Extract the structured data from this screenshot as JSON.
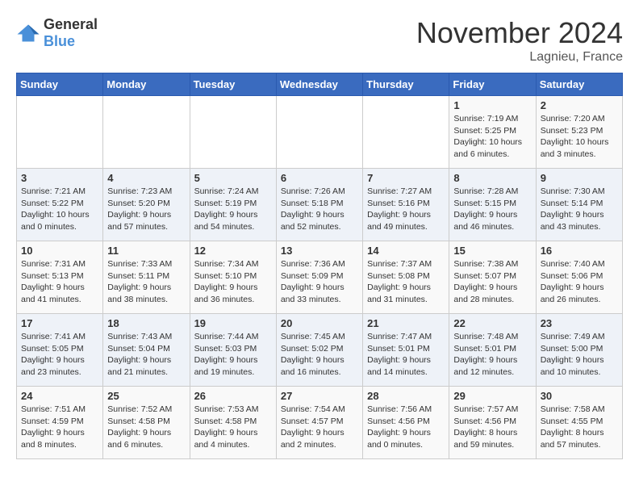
{
  "logo": {
    "general": "General",
    "blue": "Blue"
  },
  "title": "November 2024",
  "location": "Lagnieu, France",
  "days_of_week": [
    "Sunday",
    "Monday",
    "Tuesday",
    "Wednesday",
    "Thursday",
    "Friday",
    "Saturday"
  ],
  "weeks": [
    [
      {
        "day": "",
        "info": ""
      },
      {
        "day": "",
        "info": ""
      },
      {
        "day": "",
        "info": ""
      },
      {
        "day": "",
        "info": ""
      },
      {
        "day": "",
        "info": ""
      },
      {
        "day": "1",
        "info": "Sunrise: 7:19 AM\nSunset: 5:25 PM\nDaylight: 10 hours\nand 6 minutes."
      },
      {
        "day": "2",
        "info": "Sunrise: 7:20 AM\nSunset: 5:23 PM\nDaylight: 10 hours\nand 3 minutes."
      }
    ],
    [
      {
        "day": "3",
        "info": "Sunrise: 7:21 AM\nSunset: 5:22 PM\nDaylight: 10 hours\nand 0 minutes."
      },
      {
        "day": "4",
        "info": "Sunrise: 7:23 AM\nSunset: 5:20 PM\nDaylight: 9 hours\nand 57 minutes."
      },
      {
        "day": "5",
        "info": "Sunrise: 7:24 AM\nSunset: 5:19 PM\nDaylight: 9 hours\nand 54 minutes."
      },
      {
        "day": "6",
        "info": "Sunrise: 7:26 AM\nSunset: 5:18 PM\nDaylight: 9 hours\nand 52 minutes."
      },
      {
        "day": "7",
        "info": "Sunrise: 7:27 AM\nSunset: 5:16 PM\nDaylight: 9 hours\nand 49 minutes."
      },
      {
        "day": "8",
        "info": "Sunrise: 7:28 AM\nSunset: 5:15 PM\nDaylight: 9 hours\nand 46 minutes."
      },
      {
        "day": "9",
        "info": "Sunrise: 7:30 AM\nSunset: 5:14 PM\nDaylight: 9 hours\nand 43 minutes."
      }
    ],
    [
      {
        "day": "10",
        "info": "Sunrise: 7:31 AM\nSunset: 5:13 PM\nDaylight: 9 hours\nand 41 minutes."
      },
      {
        "day": "11",
        "info": "Sunrise: 7:33 AM\nSunset: 5:11 PM\nDaylight: 9 hours\nand 38 minutes."
      },
      {
        "day": "12",
        "info": "Sunrise: 7:34 AM\nSunset: 5:10 PM\nDaylight: 9 hours\nand 36 minutes."
      },
      {
        "day": "13",
        "info": "Sunrise: 7:36 AM\nSunset: 5:09 PM\nDaylight: 9 hours\nand 33 minutes."
      },
      {
        "day": "14",
        "info": "Sunrise: 7:37 AM\nSunset: 5:08 PM\nDaylight: 9 hours\nand 31 minutes."
      },
      {
        "day": "15",
        "info": "Sunrise: 7:38 AM\nSunset: 5:07 PM\nDaylight: 9 hours\nand 28 minutes."
      },
      {
        "day": "16",
        "info": "Sunrise: 7:40 AM\nSunset: 5:06 PM\nDaylight: 9 hours\nand 26 minutes."
      }
    ],
    [
      {
        "day": "17",
        "info": "Sunrise: 7:41 AM\nSunset: 5:05 PM\nDaylight: 9 hours\nand 23 minutes."
      },
      {
        "day": "18",
        "info": "Sunrise: 7:43 AM\nSunset: 5:04 PM\nDaylight: 9 hours\nand 21 minutes."
      },
      {
        "day": "19",
        "info": "Sunrise: 7:44 AM\nSunset: 5:03 PM\nDaylight: 9 hours\nand 19 minutes."
      },
      {
        "day": "20",
        "info": "Sunrise: 7:45 AM\nSunset: 5:02 PM\nDaylight: 9 hours\nand 16 minutes."
      },
      {
        "day": "21",
        "info": "Sunrise: 7:47 AM\nSunset: 5:01 PM\nDaylight: 9 hours\nand 14 minutes."
      },
      {
        "day": "22",
        "info": "Sunrise: 7:48 AM\nSunset: 5:01 PM\nDaylight: 9 hours\nand 12 minutes."
      },
      {
        "day": "23",
        "info": "Sunrise: 7:49 AM\nSunset: 5:00 PM\nDaylight: 9 hours\nand 10 minutes."
      }
    ],
    [
      {
        "day": "24",
        "info": "Sunrise: 7:51 AM\nSunset: 4:59 PM\nDaylight: 9 hours\nand 8 minutes."
      },
      {
        "day": "25",
        "info": "Sunrise: 7:52 AM\nSunset: 4:58 PM\nDaylight: 9 hours\nand 6 minutes."
      },
      {
        "day": "26",
        "info": "Sunrise: 7:53 AM\nSunset: 4:58 PM\nDaylight: 9 hours\nand 4 minutes."
      },
      {
        "day": "27",
        "info": "Sunrise: 7:54 AM\nSunset: 4:57 PM\nDaylight: 9 hours\nand 2 minutes."
      },
      {
        "day": "28",
        "info": "Sunrise: 7:56 AM\nSunset: 4:56 PM\nDaylight: 9 hours\nand 0 minutes."
      },
      {
        "day": "29",
        "info": "Sunrise: 7:57 AM\nSunset: 4:56 PM\nDaylight: 8 hours\nand 59 minutes."
      },
      {
        "day": "30",
        "info": "Sunrise: 7:58 AM\nSunset: 4:55 PM\nDaylight: 8 hours\nand 57 minutes."
      }
    ]
  ]
}
